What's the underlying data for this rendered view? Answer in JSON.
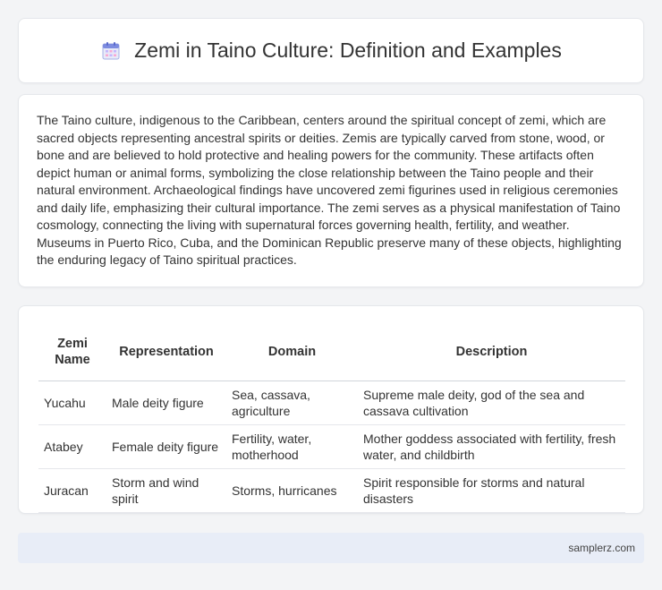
{
  "header": {
    "title": "Zemi in Taino Culture: Definition and Examples",
    "icon": "calendar-icon"
  },
  "intro": {
    "text": "The Taino culture, indigenous to the Caribbean, centers around the spiritual concept of zemi, which are sacred objects representing ancestral spirits or deities. Zemis are typically carved from stone, wood, or bone and are believed to hold protective and healing powers for the community. These artifacts often depict human or animal forms, symbolizing the close relationship between the Taino people and their natural environment. Archaeological findings have uncovered zemi figurines used in religious ceremonies and daily life, emphasizing their cultural importance. The zemi serves as a physical manifestation of Taino cosmology, connecting the living with supernatural forces governing health, fertility, and weather. Museums in Puerto Rico, Cuba, and the Dominican Republic preserve many of these objects, highlighting the enduring legacy of Taino spiritual practices."
  },
  "table": {
    "headers": [
      "Zemi Name",
      "Representation",
      "Domain",
      "Description"
    ],
    "rows": [
      [
        "Yucahu",
        "Male deity figure",
        "Sea, cassava, agriculture",
        "Supreme male deity, god of the sea and cassava cultivation"
      ],
      [
        "Atabey",
        "Female deity figure",
        "Fertility, water, motherhood",
        "Mother goddess associated with fertility, fresh water, and childbirth"
      ],
      [
        "Juracan",
        "Storm and wind spirit",
        "Storms, hurricanes",
        "Spirit responsible for storms and natural disasters"
      ]
    ]
  },
  "footer": {
    "site": "samplerz.com"
  },
  "colors": {
    "background": "#f3f4f6",
    "card": "#ffffff",
    "footer": "#e8edf7",
    "icon_accent": "#6b7cd6"
  }
}
